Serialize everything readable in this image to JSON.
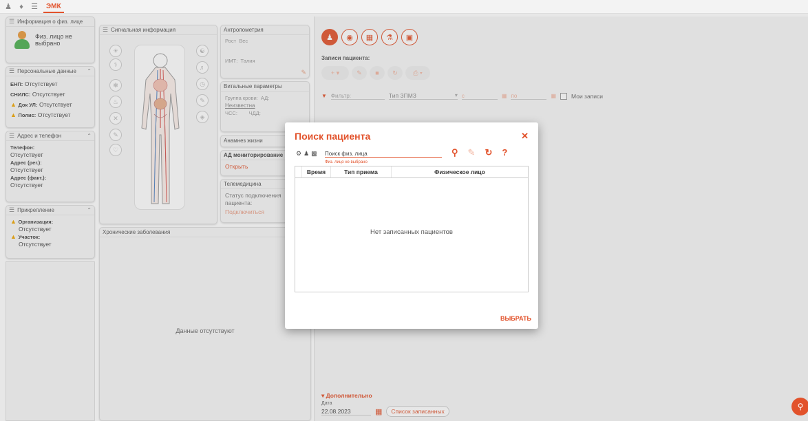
{
  "topbar": {
    "tab_label": "ЭМК"
  },
  "person_panel": {
    "title": "Информация о физ. лице",
    "name": "Физ. лицо не выбрано"
  },
  "personal_panel": {
    "title": "Персональные данные",
    "enp_label": "ЕНП:",
    "enp_value": "Отсутствует",
    "snils_label": "СНИЛС:",
    "snils_value": "Отсутствует",
    "doc_label": "Док УЛ:",
    "doc_value": "Отсутствует",
    "policy_label": "Полис:",
    "policy_value": "Отсутствует"
  },
  "address_panel": {
    "title": "Адрес и телефон",
    "phone_label": "Телефон:",
    "phone_value": "Отсутствует",
    "reg_label": "Адрес (рег.):",
    "reg_value": "Отсутствует",
    "fact_label": "Адрес (факт.):",
    "fact_value": "Отсутствует"
  },
  "attach_panel": {
    "title": "Прикрепление",
    "org_label": "Организация:",
    "org_value": "Отсутствует",
    "area_label": "Участок:",
    "area_value": "Отсутствует"
  },
  "signal_panel": {
    "title": "Сигнальная информация"
  },
  "chronic_panel": {
    "title": "Хронические заболевания",
    "empty": "Данные отсутствуют"
  },
  "anthro_panel": {
    "title": "Антропометрия",
    "height": "Рост",
    "weight": "Вес",
    "bmi": "ИМТ:",
    "waist": "Талия"
  },
  "vital_panel": {
    "title": "Витальные параметры",
    "blood_label": "Группа крови:",
    "bp_label": "АД:",
    "blood_value": "Неизвестна",
    "hr_label": "ЧСС:",
    "rr_label": "ЧДД:"
  },
  "anamnesis_panel": {
    "title": "Анамнез жизни"
  },
  "monitoring_panel": {
    "title": "АД мониторирование",
    "open": "Открыть"
  },
  "tele_panel": {
    "title": "Телемедицина",
    "status": "Статус подключения пациента:",
    "connect": "Подключиться"
  },
  "records": {
    "title": "Записи пациента:",
    "filter_label": "Фильтр:",
    "type_label": "Тип ЗПМЗ",
    "from_label": "с",
    "to_label": "по",
    "my_records": "Мои записи",
    "extra_label": "Дополнительно",
    "date_label": "Дата",
    "date_value": "22.08.2023",
    "list_button": "Список записанных"
  },
  "dialog": {
    "title": "Поиск пациента",
    "search_placeholder": "Поиск физ. лица",
    "search_hint": "Физ. лицо не выбрано",
    "col_time": "Время",
    "col_type": "Тип приема",
    "col_person": "Физическое лицо",
    "empty": "Нет записанных пациентов",
    "select_button": "ВЫБРАТЬ"
  },
  "colors": {
    "accent": "#e2522b",
    "warning": "#f0a500"
  }
}
